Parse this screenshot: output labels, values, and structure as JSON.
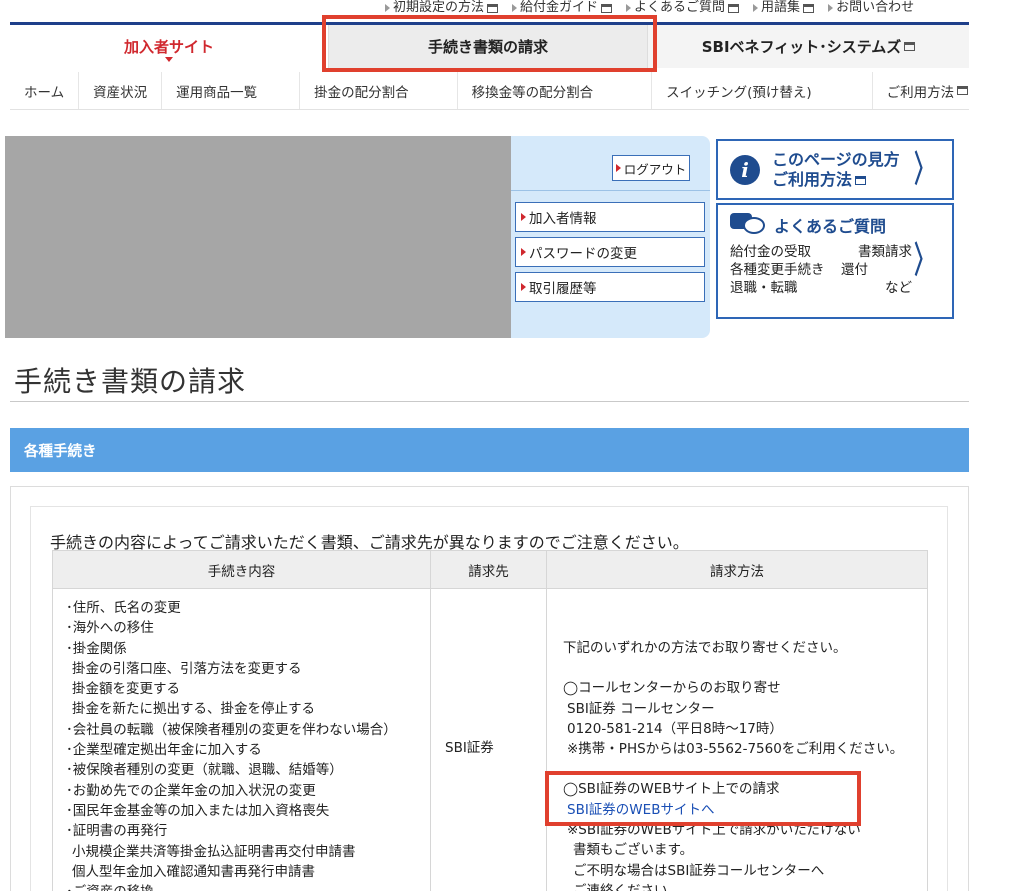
{
  "utility_links": [
    {
      "label": "初期設定の方法",
      "ext": true
    },
    {
      "label": "給付金ガイド",
      "ext": true
    },
    {
      "label": "よくあるご質問",
      "ext": true
    },
    {
      "label": "用語集",
      "ext": true
    },
    {
      "label": "お問い合わせ",
      "ext": false
    }
  ],
  "tabs": {
    "member": "加入者サイト",
    "forms": "手続き書類の請求",
    "sbi": "SBIベネフィット･システムズ"
  },
  "subnav": [
    "ホーム",
    "資産状況",
    "運用商品一覧",
    "掛金の配分割合",
    "移換金等の配分割合",
    "スイッチング(預け替え)",
    "ご利用方法"
  ],
  "account": {
    "logout": "ログアウト",
    "links": [
      "加入者情報",
      "パスワードの変更",
      "取引履歴等"
    ]
  },
  "help": {
    "line1": "このページの見方",
    "line2": "ご利用方法"
  },
  "faq": {
    "title": "よくあるご質問",
    "row1a": "給付金の受取",
    "row1b": "書類請求",
    "row2a": "各種変更手続き",
    "row2b": "還付",
    "row3a": "退職・転職",
    "row3b": "など"
  },
  "page_title": "手続き書類の請求",
  "section_title": "各種手続き",
  "notice": "手続きの内容によってご請求いただく書類、ご請求先が異なりますのでご注意ください。",
  "table": {
    "headers": [
      "手続き内容",
      "請求先",
      "請求方法"
    ],
    "procedures": [
      {
        "text": "･住所、氏名の変更",
        "indent": false
      },
      {
        "text": "･海外への移住",
        "indent": false
      },
      {
        "text": "･掛金関係",
        "indent": false
      },
      {
        "text": "掛金の引落口座、引落方法を変更する",
        "indent": true
      },
      {
        "text": "掛金額を変更する",
        "indent": true
      },
      {
        "text": "掛金を新たに拠出する、掛金を停止する",
        "indent": true
      },
      {
        "text": "･会社員の転職（被保険者種別の変更を伴わない場合）",
        "indent": false
      },
      {
        "text": "･企業型確定拠出年金に加入する",
        "indent": false
      },
      {
        "text": "･被保険者種別の変更（就職、退職、結婚等）",
        "indent": false
      },
      {
        "text": "･お勤め先での企業年金の加入状況の変更",
        "indent": false
      },
      {
        "text": "･国民年金基金等の加入または加入資格喪失",
        "indent": false
      },
      {
        "text": "･証明書の再発行",
        "indent": false
      },
      {
        "text": "小規模企業共済等掛金払込証明書再交付申請書",
        "indent": true
      },
      {
        "text": "個人型年金加入確認通知書再発行申請書",
        "indent": true
      },
      {
        "text": "･ご資産の移換",
        "indent": false
      }
    ],
    "destination": "SBI証券",
    "method": {
      "intro": "下記のいずれかの方法でお取り寄せください。",
      "call_title": "◯コールセンターからのお取り寄せ",
      "call_name": "SBI証券 コールセンター",
      "call_number": "0120-581-214（平日8時～17時）",
      "call_mobile": "※携帯・PHSからは03-5562-7560をご利用ください。",
      "web_title": "◯SBI証券のWEBサイト上での請求",
      "web_link": "SBI証券のWEBサイトへ",
      "web_note1": "※SBI証券のWEBサイト上で請求がいただけない",
      "web_note2": "書類もございます。",
      "web_note3": "ご不明な場合はSBI証券コールセンターへ",
      "web_note4": "ご連絡ください。"
    }
  }
}
